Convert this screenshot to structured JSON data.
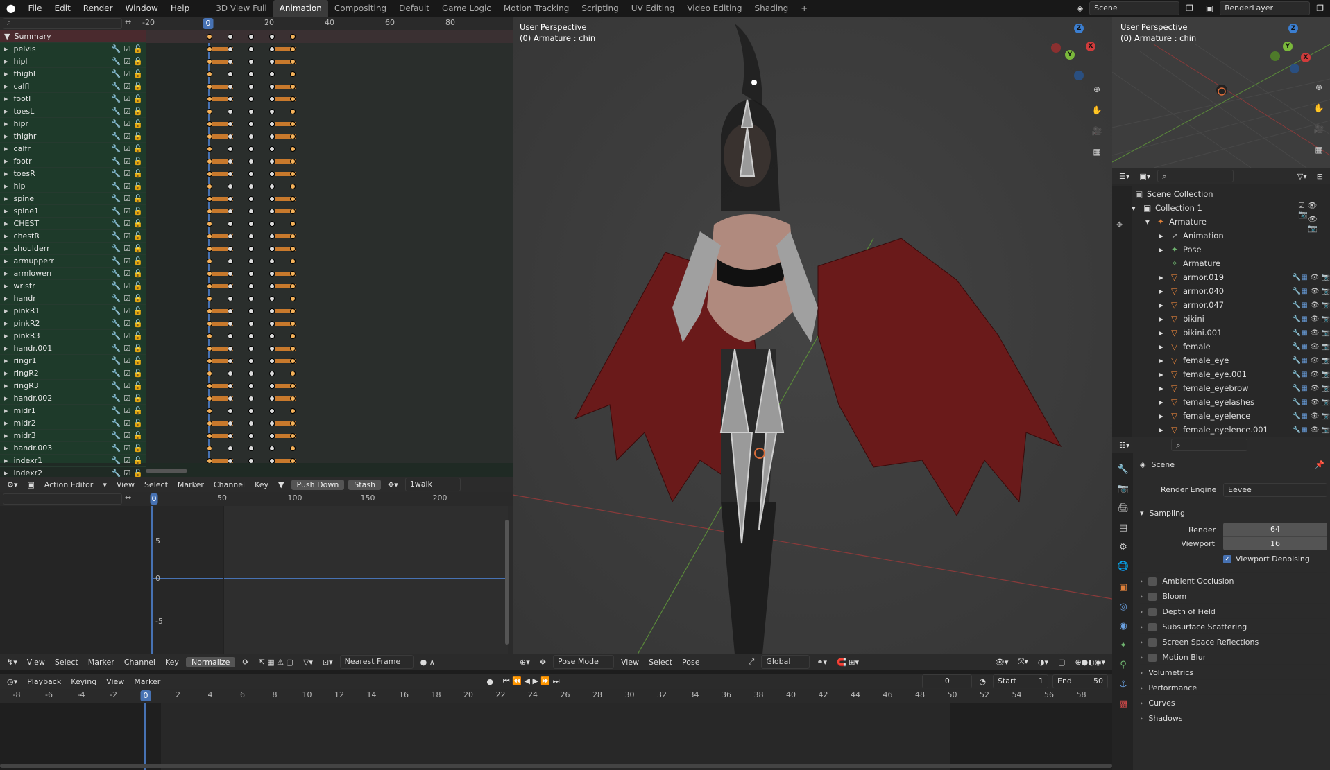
{
  "menus": [
    "File",
    "Edit",
    "Render",
    "Window",
    "Help"
  ],
  "workspaces": [
    "3D View Full",
    "Animation",
    "Compositing",
    "Default",
    "Game Logic",
    "Motion Tracking",
    "Scripting",
    "UV Editing",
    "Video Editing",
    "Shading"
  ],
  "active_workspace": "Animation",
  "scene_name": "Scene",
  "render_layer": "RenderLayer",
  "dopesheet": {
    "ruler": [
      "-20",
      "0",
      "20",
      "40",
      "60",
      "80"
    ],
    "current_frame": "0",
    "summary": "Summary",
    "channels": [
      "pelvis",
      "hipl",
      "thighl",
      "calfl",
      "footl",
      "toesL",
      "hipr",
      "thighr",
      "calfr",
      "footr",
      "toesR",
      "hip",
      "spine",
      "spine1",
      "CHEST",
      "chestR",
      "shoulderr",
      "armupperr",
      "armlowerr",
      "wristr",
      "handr",
      "pinkR1",
      "pinkR2",
      "pinkR3",
      "handr.001",
      "ringr1",
      "ringR2",
      "ringR3",
      "handr.002",
      "midr1",
      "midr2",
      "midr3",
      "handr.003",
      "indexr1",
      "indexr2"
    ],
    "header": {
      "editor": "Action Editor",
      "view": "View",
      "select": "Select",
      "marker": "Marker",
      "channel": "Channel",
      "key": "Key",
      "push_down": "Push Down",
      "stash": "Stash",
      "action": "1walk"
    }
  },
  "graph": {
    "ruler": [
      "0",
      "50",
      "100",
      "150",
      "200"
    ],
    "yticks": [
      "5",
      "0",
      "-5"
    ],
    "header": {
      "view": "View",
      "select": "Select",
      "marker": "Marker",
      "channel": "Channel",
      "key": "Key",
      "normalize": "Normalize",
      "snap": "Nearest Frame"
    }
  },
  "viewport": {
    "title": "User Perspective",
    "subtitle": "(0) Armature : chin",
    "header": {
      "mode": "Pose Mode",
      "view": "View",
      "select": "Select",
      "pose": "Pose",
      "orientation": "Global"
    }
  },
  "mini_viewport": {
    "title": "User Perspective",
    "subtitle": "(0) Armature : chin"
  },
  "timeline": {
    "header": {
      "playback": "Playback",
      "keying": "Keying",
      "view": "View",
      "marker": "Marker",
      "frame": "0",
      "start_label": "Start",
      "start": "1",
      "end_label": "End",
      "end": "50"
    },
    "ruler": [
      "-8",
      "-6",
      "-4",
      "-2",
      "0",
      "2",
      "4",
      "6",
      "8",
      "10",
      "12",
      "14",
      "16",
      "18",
      "20",
      "22",
      "24",
      "26",
      "28",
      "30",
      "32",
      "34",
      "36",
      "38",
      "40",
      "42",
      "44",
      "46",
      "48",
      "50",
      "52",
      "54",
      "56",
      "58"
    ]
  },
  "outliner": {
    "scene_collection": "Scene Collection",
    "collection": "Collection 1",
    "armature": "Armature",
    "children": [
      "Animation",
      "Pose",
      "Armature"
    ],
    "objects": [
      "armor.019",
      "armor.040",
      "armor.047",
      "bikini",
      "bikini.001",
      "female",
      "female_eye",
      "female_eye.001",
      "female_eyebrow",
      "female_eyelashes",
      "female_eyelence",
      "female_eyelence.001"
    ]
  },
  "properties": {
    "context": "Scene",
    "render_engine_label": "Render Engine",
    "render_engine": "Eevee",
    "sampling": "Sampling",
    "render_label": "Render",
    "render_value": "64",
    "viewport_label": "Viewport",
    "viewport_value": "16",
    "denoise": "Viewport Denoising",
    "panels": [
      "Ambient Occlusion",
      "Bloom",
      "Depth of Field",
      "Subsurface Scattering",
      "Screen Space Reflections",
      "Motion Blur",
      "Volumetrics",
      "Performance",
      "Curves",
      "Shadows"
    ]
  }
}
